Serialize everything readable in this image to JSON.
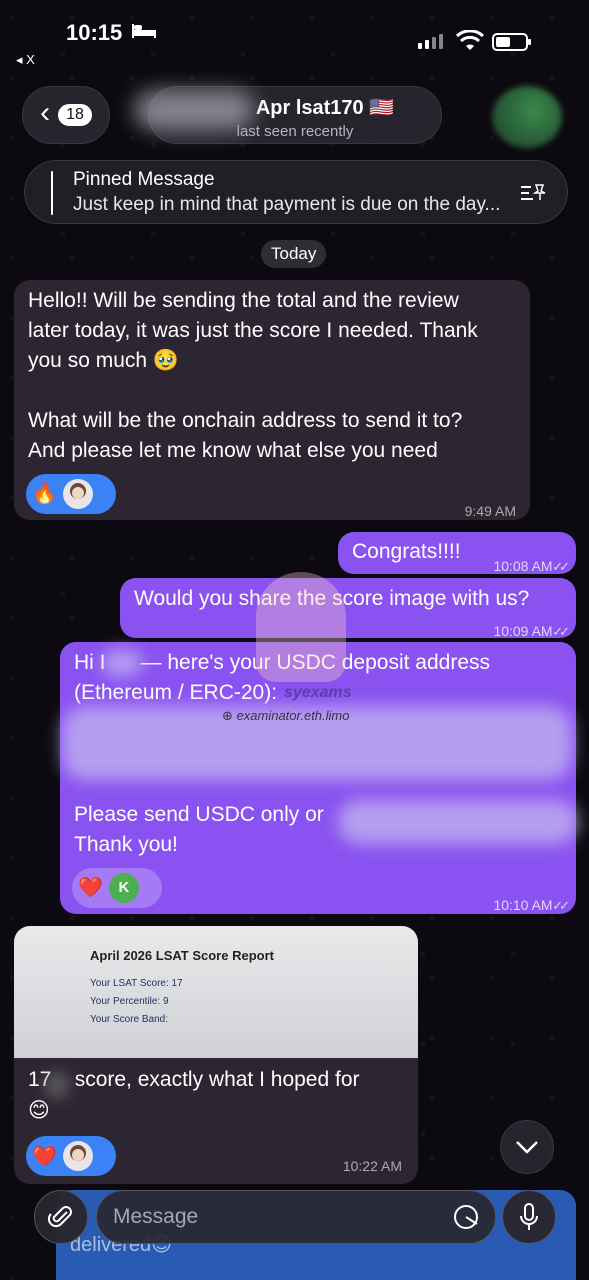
{
  "status_bar": {
    "time": "10:15",
    "back_app": "◂ X"
  },
  "header": {
    "back_count": "18",
    "chat_name": "Apr lsat170 🇺🇸",
    "chat_status": "last seen recently"
  },
  "pinned": {
    "title": "Pinned Message",
    "text": "Just keep in mind that payment is due on the day..."
  },
  "date_chip": "Today",
  "messages": [
    {
      "direction": "incoming",
      "lines": [
        "Hello!! Will be sending the total and the review",
        "later today, it was just the score I needed. Thank",
        "you so much 🥹",
        "",
        "What will be the onchain address to send it to?",
        "And please let me know what else you need"
      ],
      "reactions": [
        "🔥"
      ],
      "time": "9:49 AM"
    },
    {
      "direction": "outgoing",
      "text": "Congrats!!!!",
      "time": "10:08 AM"
    },
    {
      "direction": "outgoing",
      "text": "Would you share the score image with us?",
      "time": "10:09 AM"
    },
    {
      "direction": "outgoing",
      "line1": "Hi I      — here's your USDC deposit address",
      "line2": "(Ethereum / ERC-20):",
      "line3": "Please send USDC only or",
      "line4": "Thank you!",
      "reactions": [
        "❤️",
        "K"
      ],
      "time": "10:10 AM"
    },
    {
      "direction": "incoming",
      "photo": {
        "title": "April 2026 LSAT Score Report",
        "line1": "Your LSAT Score: 17",
        "line2": "Your Percentile: 9",
        "line3": "Your Score Band:"
      },
      "line1": "17    score, exactly what I hoped for",
      "line2": "😊",
      "reactions": [
        "❤️"
      ],
      "time": "10:22 AM"
    }
  ],
  "watermark": {
    "brand": "syexams",
    "site": "examinator.eth.limo"
  },
  "bottom_ghost_text": "delivered😊",
  "composer": {
    "placeholder": "Message"
  }
}
